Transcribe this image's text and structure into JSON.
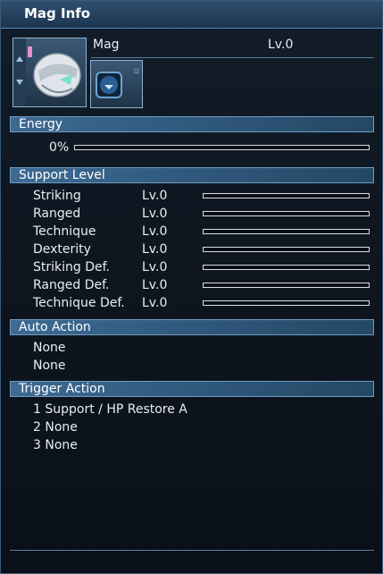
{
  "window": {
    "title": "Mag Info"
  },
  "mag": {
    "name": "Mag",
    "level": "Lv.0"
  },
  "energy": {
    "section_label": "Energy",
    "percent_text": "0%",
    "value": 0
  },
  "support_level": {
    "section_label": "Support Level",
    "stats": [
      {
        "name": "Striking",
        "level": "Lv.0",
        "progress": 0
      },
      {
        "name": "Ranged",
        "level": "Lv.0",
        "progress": 0
      },
      {
        "name": "Technique",
        "level": "Lv.0",
        "progress": 0
      },
      {
        "name": "Dexterity",
        "level": "Lv.0",
        "progress": 0
      },
      {
        "name": "Striking Def.",
        "level": "Lv.0",
        "progress": 0
      },
      {
        "name": "Ranged Def.",
        "level": "Lv.0",
        "progress": 0
      },
      {
        "name": "Technique Def.",
        "level": "Lv.0",
        "progress": 0
      }
    ]
  },
  "auto_action": {
    "section_label": "Auto Action",
    "items": [
      "None",
      "None"
    ]
  },
  "trigger_action": {
    "section_label": "Trigger Action",
    "items": [
      "1 Support / HP Restore A",
      "2 None",
      "3 None"
    ]
  },
  "colors": {
    "accent": "#3d6a92",
    "bar_fill": "#8ed0ff",
    "panel": "#0e1620"
  }
}
